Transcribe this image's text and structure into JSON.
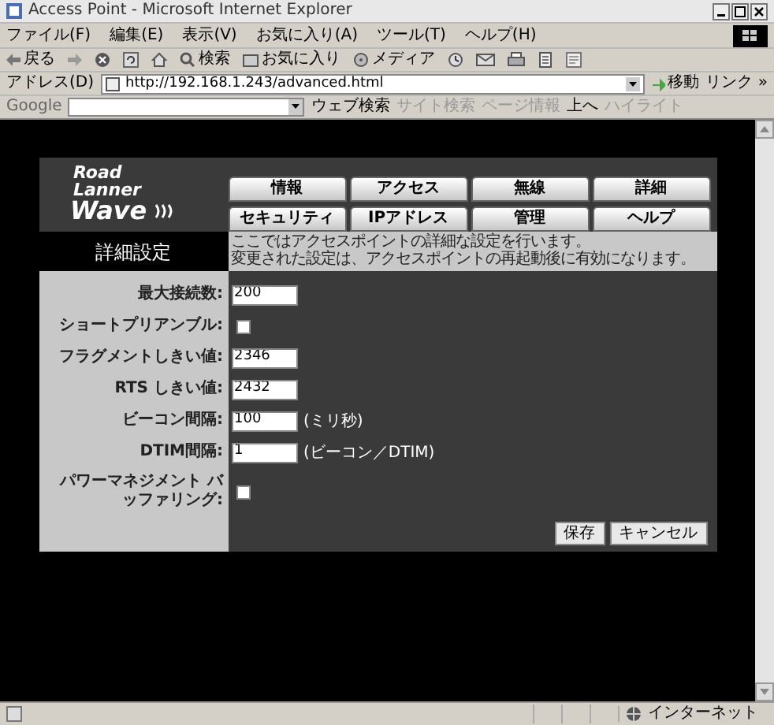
{
  "window": {
    "title": "Access Point - Microsoft Internet Explorer"
  },
  "menu": [
    "ファイル(F)",
    "編集(E)",
    "表示(V)",
    "お気に入り(A)",
    "ツール(T)",
    "ヘルプ(H)"
  ],
  "toolbar": {
    "back": "戻る",
    "search": "検索",
    "favorites": "お気に入り",
    "media": "メディア"
  },
  "address_bar": {
    "label": "アドレス(D)",
    "value": "http://192.168.1.243/advanced.html",
    "go": "移動",
    "links": "リンク »"
  },
  "google_bar": {
    "logo": "Google",
    "web_search": "ウェブ検索",
    "site_search": "サイト検索",
    "page_info": "ページ情報",
    "up": "上へ",
    "highlight": "ハイライト"
  },
  "page": {
    "logo": [
      "Road",
      "Lanner",
      "Wave"
    ],
    "tabs": [
      {
        "label": "情報",
        "selected": false
      },
      {
        "label": "アクセス",
        "selected": false
      },
      {
        "label": "無線",
        "selected": false
      },
      {
        "label": "詳細",
        "selected": false
      },
      {
        "label": "セキュリティ",
        "selected": false
      },
      {
        "label": "IPアドレス",
        "selected": false
      },
      {
        "label": "管理",
        "selected": false
      },
      {
        "label": "ヘルプ",
        "selected": false
      }
    ],
    "heading": "詳細設定",
    "description": [
      "ここではアクセスポイントの詳細な設定を行います。",
      "変更された設定は、アクセスポイントの再起動後に有効になります。"
    ],
    "fields": [
      {
        "kind": "text",
        "label": "最大接続数:",
        "value": "200"
      },
      {
        "kind": "checkbox",
        "label": "ショートプリアンブル:",
        "checked": false
      },
      {
        "kind": "text",
        "label": "フラグメントしきい値:",
        "value": "2346"
      },
      {
        "kind": "text",
        "label": "RTS しきい値:",
        "value": "2432"
      },
      {
        "kind": "text",
        "label": "ビーコン間隔:",
        "value": "100",
        "unit": "(ミリ秒)"
      },
      {
        "kind": "text",
        "label": "DTIM間隔:",
        "value": "1",
        "unit": "(ビーコン／DTIM)"
      },
      {
        "kind": "checkbox",
        "label": "パワーマネジメント バッファリング:",
        "checked": false
      }
    ],
    "buttons": [
      "保存",
      "キャンセル"
    ]
  },
  "status_bar": {
    "zone": "インターネット"
  }
}
